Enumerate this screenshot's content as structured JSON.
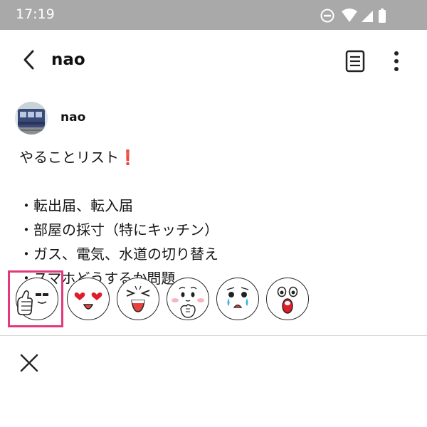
{
  "status_bar": {
    "time": "17:19",
    "icons": [
      "do-not-disturb-icon",
      "wifi-icon",
      "signal-icon",
      "battery-icon"
    ]
  },
  "header": {
    "title": "nao",
    "back_icon": "chevron-left-icon",
    "note_icon": "note-icon",
    "more_icon": "more-vertical-icon"
  },
  "post": {
    "author": "nao",
    "lines": [
      "やることリスト",
      "・転出届、転入届",
      "・部屋の採寸（特にキッチン）",
      "・ガス、電気、水道の切り替え",
      "・スマホどうするか問題"
    ],
    "title_emoji": "❗"
  },
  "reactions": [
    "thumbs-up-reaction",
    "love-reaction",
    "laugh-reaction",
    "shy-reaction",
    "sad-reaction",
    "surprised-reaction"
  ],
  "colors": {
    "status_bar": "#a9a9a9",
    "highlight": "#e3387c",
    "accent_red": "#e0242d"
  }
}
